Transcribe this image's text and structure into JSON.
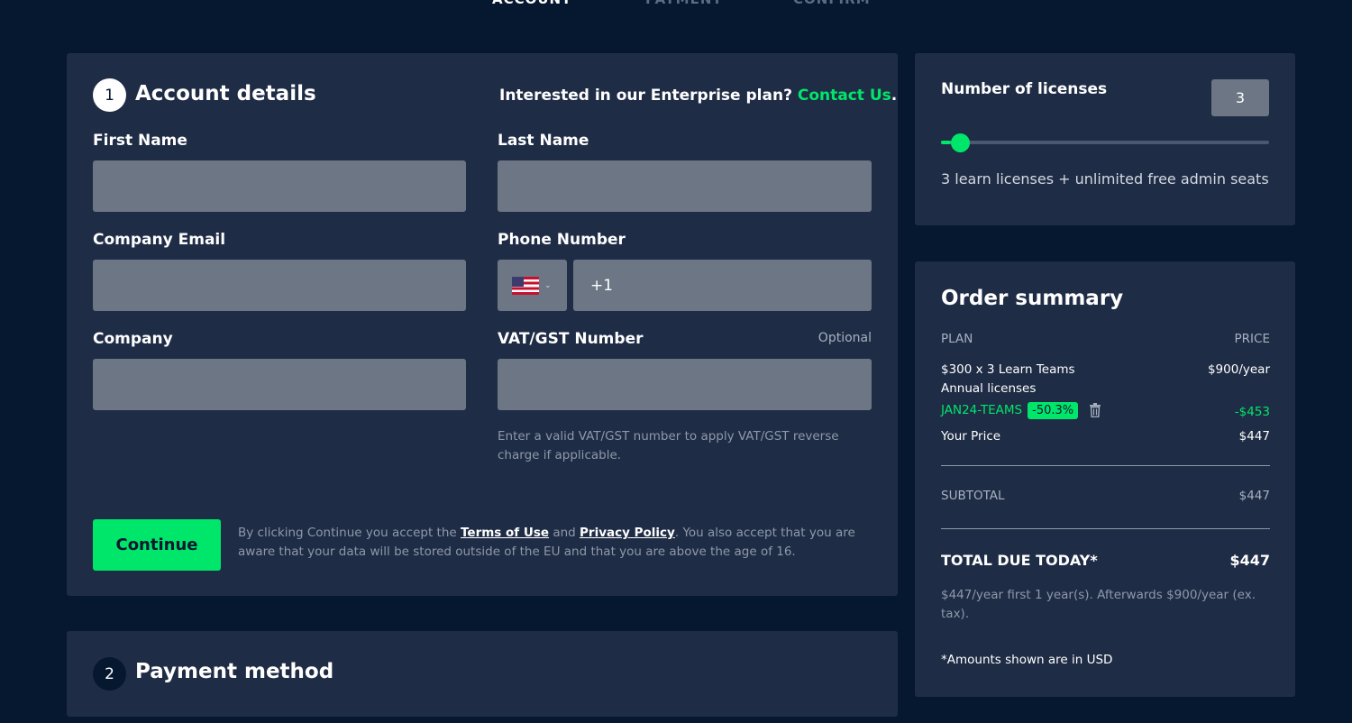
{
  "steps": [
    "ACCOUNT",
    "PAYMENT",
    "CONFIRM"
  ],
  "account": {
    "step_number": "1",
    "title": "Account details",
    "enterprise_text": "Interested in our Enterprise plan? ",
    "contact_link": "Contact Us",
    "enterprise_period": ".",
    "first_name_label": "First Name",
    "last_name_label": "Last Name",
    "email_label": "Company Email",
    "phone_label": "Phone Number",
    "phone_prefix": "+1",
    "company_label": "Company",
    "vat_label": "VAT/GST Number",
    "optional_label": "Optional",
    "vat_hint": "Enter a valid VAT/GST number to apply VAT/GST reverse charge if applicable.",
    "continue_label": "Continue",
    "legal_1": "By clicking Continue you accept the ",
    "terms_link": "Terms of Use",
    "legal_2": " and ",
    "privacy_link": "Privacy Policy",
    "legal_3": ". You also accept that you are aware that your data will be stored outside of the EU and that you are above the age of 16."
  },
  "payment": {
    "step_number": "2",
    "title": "Payment method"
  },
  "licenses": {
    "title": "Number of licenses",
    "count": "3",
    "slider_fraction": 0.03,
    "note": "3 learn licenses + unlimited free admin seats"
  },
  "summary": {
    "title": "Order summary",
    "plan_header": "PLAN",
    "price_header": "PRICE",
    "plan_line_1": "$300 x 3 Learn Teams",
    "plan_line_2": "Annual licenses",
    "plan_price": "$900/year",
    "promo_code": "JAN24-TEAMS",
    "promo_badge": "-50.3%",
    "promo_amount": "-$453",
    "your_price_label": "Your Price",
    "your_price": "$447",
    "subtotal_label": "SUBTOTAL",
    "subtotal": "$447",
    "total_label": "TOTAL DUE TODAY*",
    "total": "$447",
    "renewal_note": "$447/year first 1 year(s). Afterwards $900/year (ex. tax).",
    "usd_note": "*Amounts shown are in USD"
  },
  "colors": {
    "background": "#061730",
    "card": "#1f2c45",
    "accent": "#00e66a",
    "input": "#6c7685"
  }
}
